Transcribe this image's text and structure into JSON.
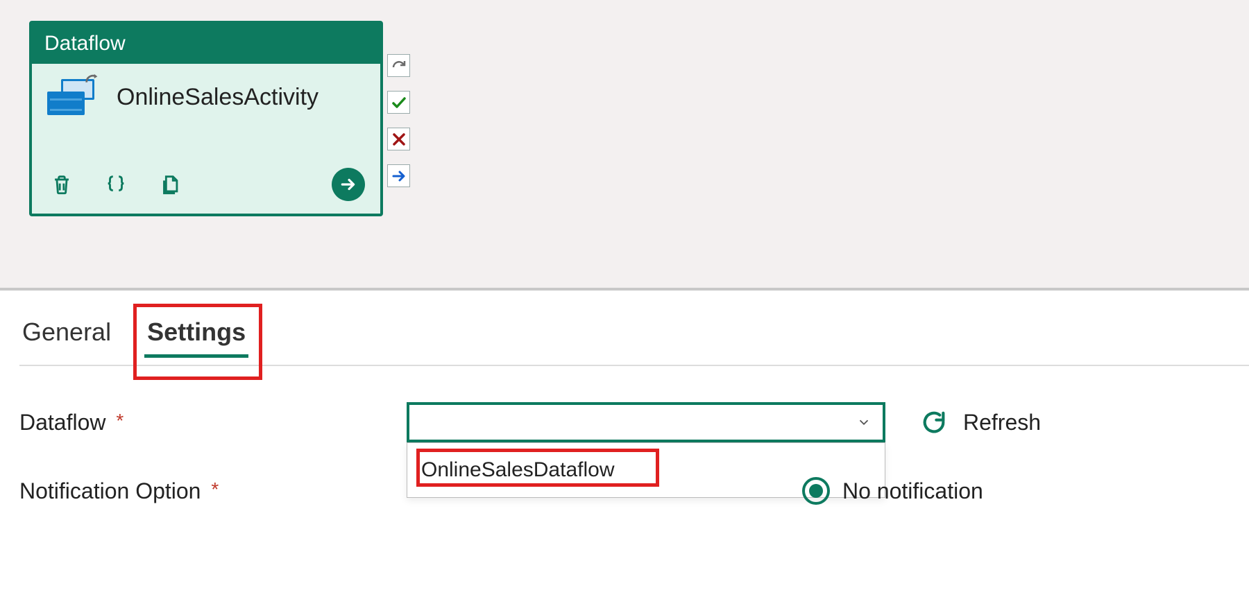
{
  "activity": {
    "type_label": "Dataflow",
    "name": "OnlineSalesActivity",
    "icons": {
      "dataflow": "dataflow-tables-icon",
      "delete": "trash-icon",
      "code": "braces-icon",
      "copy": "copy-icon",
      "run": "arrow-right-circle-icon"
    },
    "handles": {
      "undo": "redo-arrow-icon",
      "success": "check-icon",
      "failure": "x-icon",
      "next": "arrow-right-icon"
    }
  },
  "tabs": {
    "general": "General",
    "settings": "Settings",
    "active": "settings"
  },
  "settings": {
    "dataflow_label": "Dataflow",
    "dataflow_value": "",
    "dataflow_options": [
      "OnlineSalesDataflow"
    ],
    "refresh_label": "Refresh",
    "notification_label": "Notification Option",
    "notification_selected": "No notification"
  }
}
